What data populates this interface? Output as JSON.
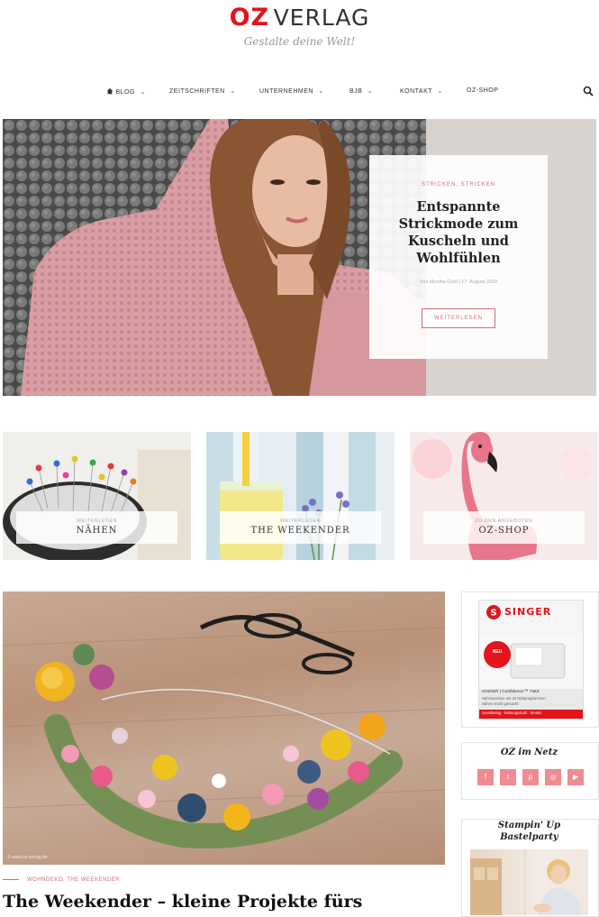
{
  "header": {
    "logo_oz": "OZ",
    "logo_verlag": "VERLAG",
    "tagline": "Gestalte deine Welt!"
  },
  "nav": {
    "items": [
      {
        "label": "BLOG",
        "icon": "home-icon"
      },
      {
        "label": "ZEITSCHRIFTEN"
      },
      {
        "label": "UNTERNEHMEN"
      },
      {
        "label": "BJB"
      },
      {
        "label": "KONTAKT"
      },
      {
        "label": "OZ-SHOP"
      }
    ],
    "chevron": "⌄",
    "search_icon": "search-icon"
  },
  "hero": {
    "category": "STRICKEN, STRICKEN",
    "title": "Entspannte Strickmode zum Kuscheln und Wohlfühlen",
    "meta": "Von Monika Gold  |  17. August 2018",
    "button": "WEITERLESEN"
  },
  "tiles": [
    {
      "category": "WEITERLESEN",
      "name": "NÄHEN"
    },
    {
      "category": "WEITERLESEN",
      "name": "THE WEEKENDER"
    },
    {
      "category": "ZU DEN ANGEBOTEN",
      "name": "OZ-SHOP"
    }
  ],
  "article": {
    "credit": "© www.oz-verlag.de",
    "category": "WOHNDEKO, THE WEEKENDER",
    "title": "The Weekender – kleine Projekte fürs"
  },
  "sidebar": {
    "ad": {
      "brand": "SINGER",
      "badge": "NEU",
      "line1": "SINGER | Confidence™ 7463",
      "line2": "Nähmaschine mit 30 Nähprogrammen",
      "line3": "Nähen leicht gemacht",
      "footer": "zuverlässig · leistungsstark · kreativ"
    },
    "social": {
      "title": "OZ im Netz",
      "buttons": [
        {
          "icon": "facebook-icon",
          "glyph": "f"
        },
        {
          "icon": "twitter-icon",
          "glyph": "t"
        },
        {
          "icon": "pinterest-icon",
          "glyph": "p"
        },
        {
          "icon": "instagram-icon",
          "glyph": "◎"
        },
        {
          "icon": "youtube-icon",
          "glyph": "▶"
        }
      ]
    },
    "party": {
      "title_line1": "Stampin' Up",
      "title_line2": "Bastelparty"
    }
  },
  "colors": {
    "brand_red": "#e3141b",
    "accent_pink": "#d46a73",
    "social_pink": "#f08b93"
  }
}
